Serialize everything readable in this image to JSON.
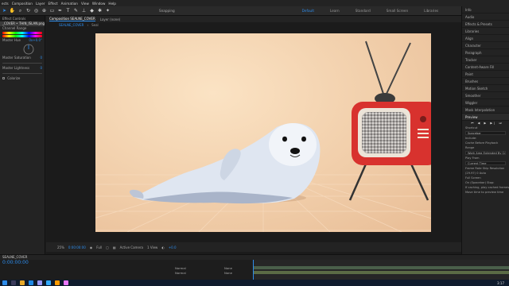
{
  "menu": [
    "ects",
    "Composition",
    "Layer",
    "Effect",
    "Animation",
    "View",
    "Window",
    "Help"
  ],
  "toolbar": {
    "snapping": "Snapping"
  },
  "workspaces": [
    "Default",
    "Learn",
    "Standard",
    "Small Screen",
    "Libraries"
  ],
  "left_panel": {
    "tab": "Effect Controls",
    "rows": [
      {
        "label": "_COVER • THIN_ISLAN.png",
        "selected": true
      },
      {
        "label": "Channel Range"
      },
      {
        "label": "Master Hue",
        "value": "0x+0.0°"
      },
      {
        "label": "Master Saturation",
        "value": "0"
      },
      {
        "label": "Master Lightness",
        "value": "0"
      },
      {
        "label": "Colorize"
      }
    ]
  },
  "comp": {
    "tab": "Composition SEALNE_COVER",
    "tab2": "Layer  (none)",
    "crumbs": [
      "SEALNE_COVER",
      "Seal"
    ]
  },
  "viewer": {
    "zoom": "25%",
    "time": "0:00:00:00",
    "quality": "Full",
    "camera": "Active Camera",
    "views": "1 View",
    "exposure": "+0.0"
  },
  "right_panel": {
    "items": [
      "Info",
      "Audio",
      "Effects & Presets",
      "Libraries",
      "Align",
      "Character",
      "Paragraph",
      "Tracker",
      "Content-Aware Fill",
      "Paint",
      "Brushes",
      "Motion Sketch",
      "Smoother",
      "Wiggler",
      "Mask Interpolation",
      "Preview"
    ],
    "shortcut_label": "Shortcut",
    "shortcut_value": "Spacebar",
    "options": [
      "Include:",
      "Cache Before Playback",
      "Range",
      "Work Area Extended By Current...",
      "Play From",
      "Current Time",
      "Frame Rate",
      "Skip",
      "Resolution",
      "(29.97)",
      "0",
      "Auto",
      "Full Screen",
      "On (Spacebar) Stop:",
      "If caching, play cached frames",
      "Move time to preview time"
    ]
  },
  "timeline": {
    "tab": "SEALNE_COVER",
    "time": "0:00:00:00",
    "modes": [
      "Normal",
      "Normal"
    ],
    "parent": [
      "None",
      "None"
    ]
  },
  "taskbar": {
    "clock": "3:17"
  }
}
